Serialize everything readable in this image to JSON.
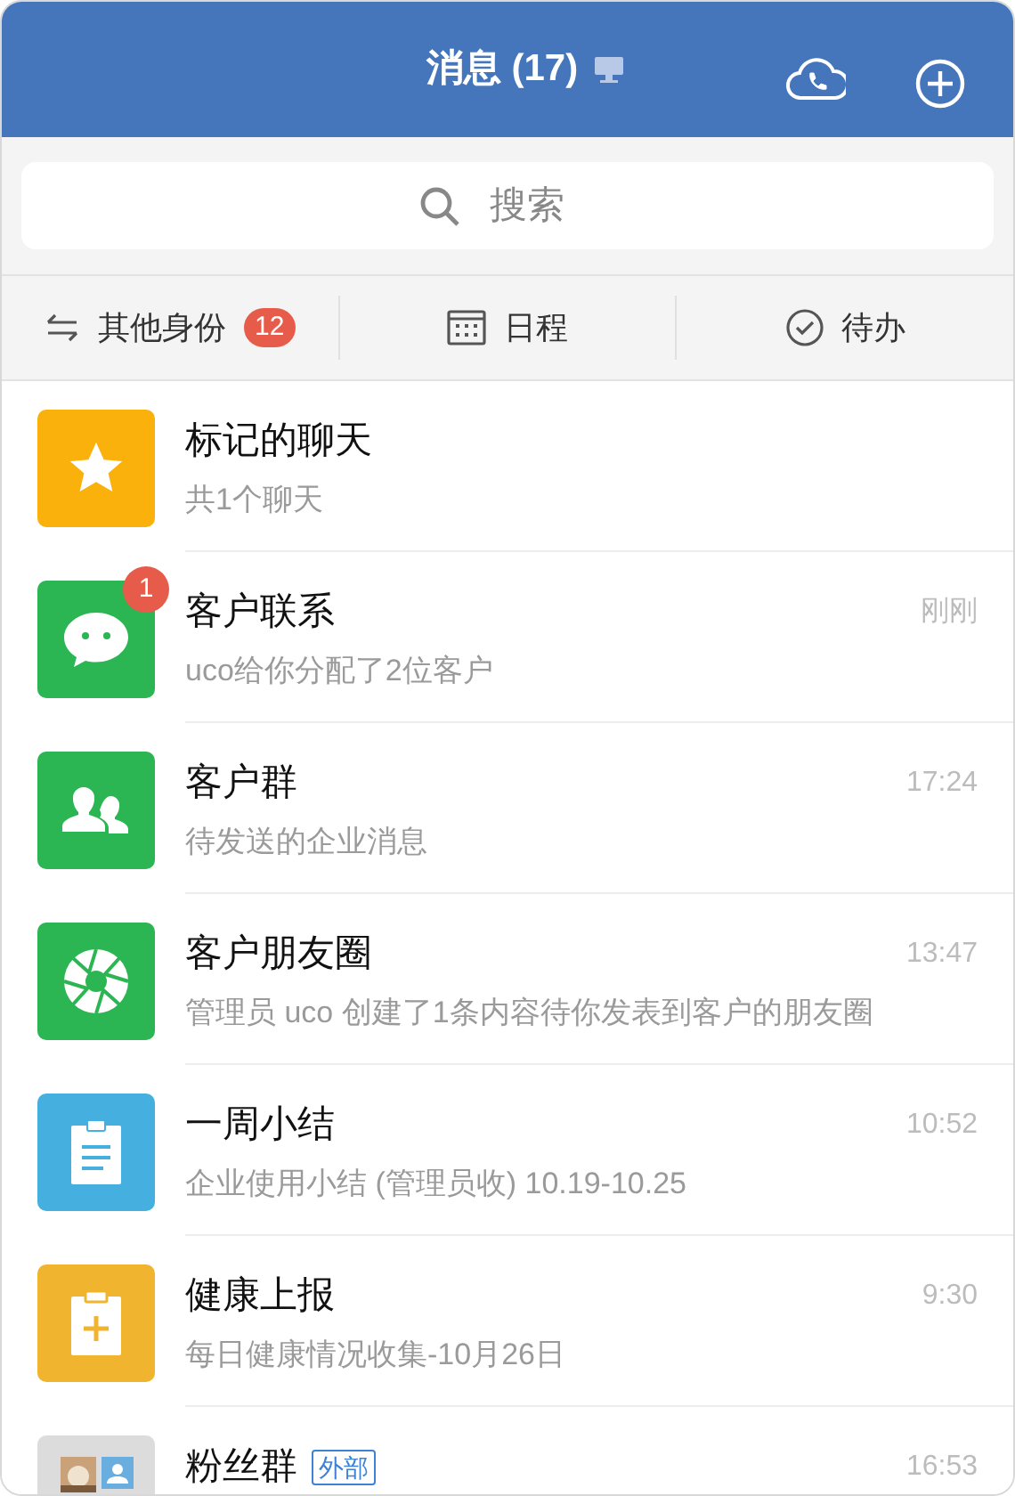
{
  "header": {
    "title": "消息 (17)"
  },
  "search": {
    "placeholder": "搜索"
  },
  "shortcuts": [
    {
      "kind": "switch",
      "label": "其他身份",
      "badge": "12"
    },
    {
      "kind": "calendar",
      "label": "日程"
    },
    {
      "kind": "todo",
      "label": "待办"
    }
  ],
  "chats": [
    {
      "kind": "star",
      "color": "#fbb10b",
      "title": "标记的聊天",
      "subtitle": "共1个聊天"
    },
    {
      "kind": "chat",
      "color": "#2cb553",
      "title": "客户联系",
      "subtitle": "uco给你分配了2位客户",
      "time": "刚刚",
      "badge": "1"
    },
    {
      "kind": "group",
      "color": "#2cb553",
      "title": "客户群",
      "subtitle": "待发送的企业消息",
      "time": "17:24"
    },
    {
      "kind": "shutter",
      "color": "#2cb553",
      "title": "客户朋友圈",
      "subtitle": "管理员 uco 创建了1条内容待你发表到客户的朋友圈",
      "time": "13:47"
    },
    {
      "kind": "report",
      "color": "#45b0e0",
      "title": "一周小结",
      "subtitle": "企业使用小结 (管理员收) 10.19-10.25",
      "time": "10:52"
    },
    {
      "kind": "health",
      "color": "#f1b42f",
      "title": "健康上报",
      "subtitle": "每日健康情况收集-10月26日",
      "time": "9:30"
    },
    {
      "kind": "avatars",
      "color": "#dcdcdc",
      "title": "粉丝群",
      "tag": "外部",
      "time": "16:53"
    }
  ]
}
